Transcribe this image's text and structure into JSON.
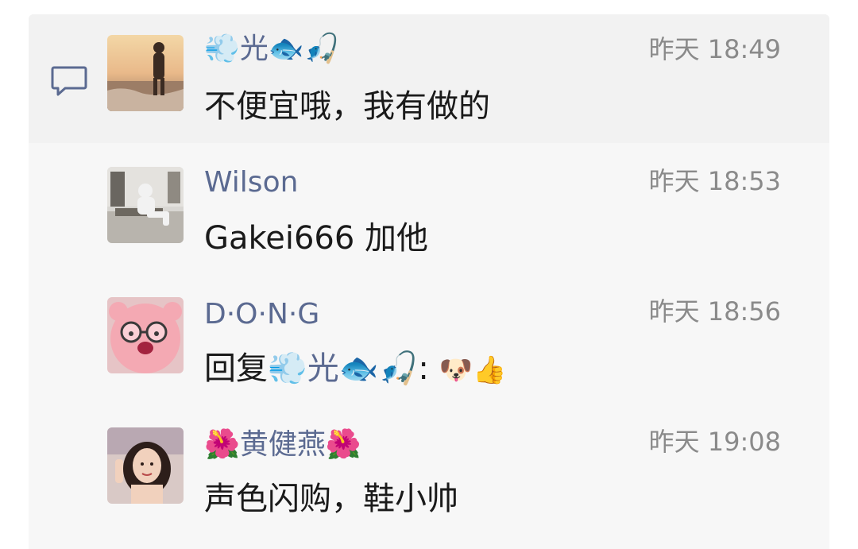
{
  "comments": [
    {
      "name": "💨光🐟🎣",
      "time": "昨天 18:49",
      "text": "不便宜哦，我有做的"
    },
    {
      "name": "Wilson",
      "time": "昨天 18:53",
      "text": "Gakei666 加他"
    },
    {
      "name": "D·O·N·G",
      "time": "昨天 18:56",
      "reply_prefix": "回复",
      "reply_to": "💨光🐟🎣",
      "reply_colon": ":",
      "text": "🐶👍"
    },
    {
      "name": "🌺黄健燕🌺",
      "time": "昨天 19:08",
      "text": "声色闪购，鞋小帅"
    }
  ],
  "colors": {
    "name": "#5b6a91",
    "time": "#8a8a8a",
    "text": "#1a1a1a",
    "panel": "#f7f7f7",
    "accent": "#5b6a91"
  },
  "icons": {
    "comment": "comment-bubble-icon"
  }
}
